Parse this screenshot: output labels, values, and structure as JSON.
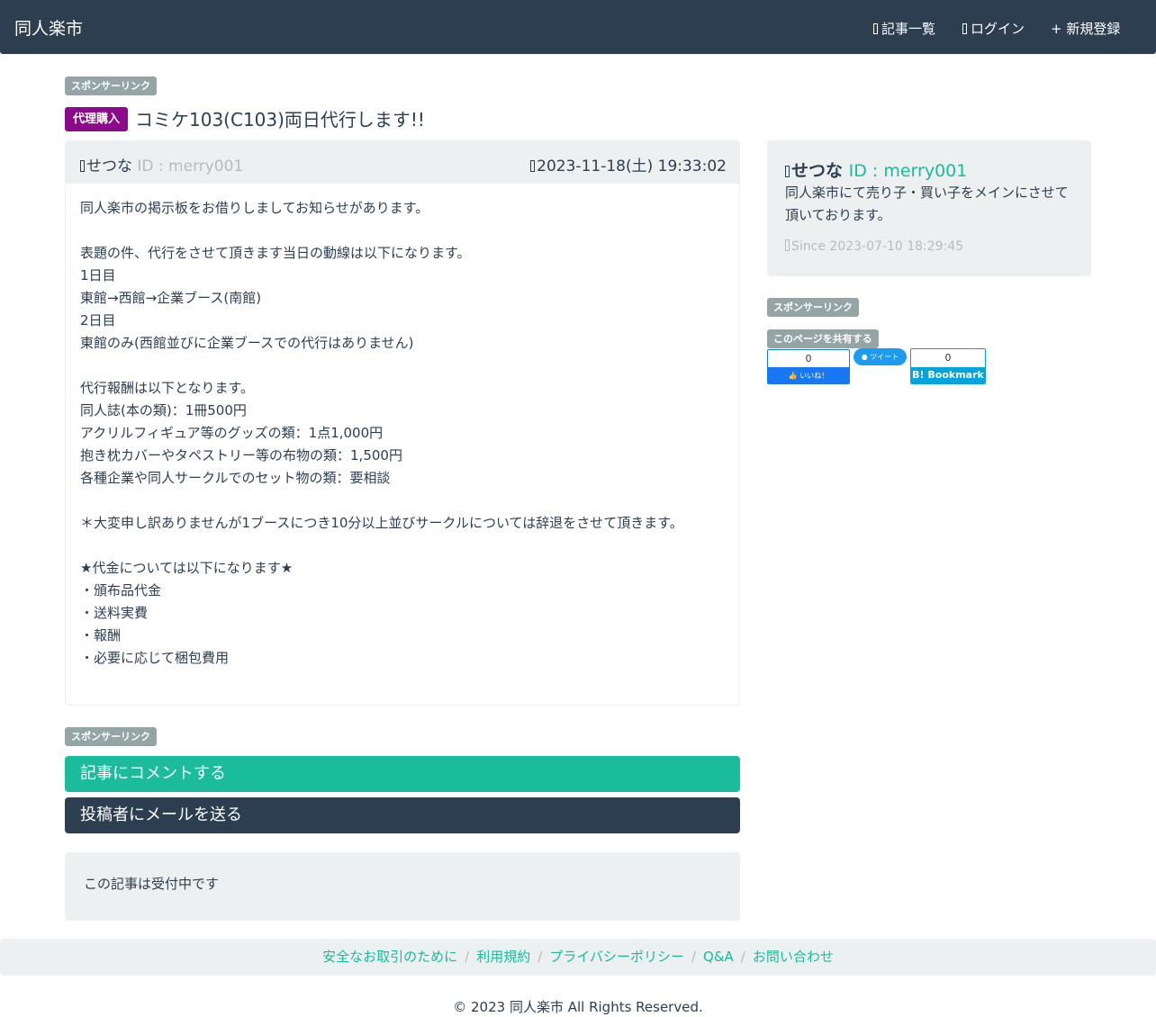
{
  "nav": {
    "brand": "同人楽市",
    "articles": "記事一覧",
    "login": "ログイン",
    "register": "+ 新規登録"
  },
  "ads": {
    "sponsor_label": "スポンサーリンク"
  },
  "post": {
    "category": "代理購入",
    "title": "コミケ103(C103)両日代行します!!",
    "author_name": "せつな",
    "author_id": "ID : merry001",
    "date": "2023-11-18(土) 19:33:02",
    "body": [
      "同人楽市の掲示板をお借りしましてお知らせがあります。",
      "",
      "表題の件、代行をさせて頂きます当日の動線は以下になります。",
      "1日目",
      "東館→西館→企業ブース(南館)",
      "2日目",
      "東館のみ(西館並びに企業ブースでの代行はありません)",
      "",
      "代行報酬は以下となります。",
      "同人誌(本の類)：1冊500円",
      "アクリルフィギュア等のグッズの類：1点1,000円",
      "抱き枕カバーやタペストリー等の布物の類：1,500円",
      "各種企業や同人サークルでのセット物の類：要相談",
      "",
      "＊大変申し訳ありませんが1ブースにつき10分以上並びサークルについては辞退をさせて頂きます。",
      "",
      "★代金については以下になります★",
      "・頒布品代金",
      "・送料実費",
      "・報酬",
      "・必要に応じて梱包費用"
    ]
  },
  "actions": {
    "comment": "記事にコメントする",
    "mail": "投稿者にメールを送る"
  },
  "status": {
    "text": "この記事は受付中です"
  },
  "sidebar": {
    "author_name": "せつな",
    "author_id": "ID : merry001",
    "description": "同人楽市にて売り子・買い子をメインにさせて頂いております。",
    "since": "Since 2023-07-10 18:29:45",
    "share_label": "このページを共有する",
    "fb_count": "0",
    "fb_button": "いいね！",
    "tw_button": "ツイート",
    "hb_count": "0",
    "hb_button": "B! Bookmark"
  },
  "footer": {
    "links": [
      "安全なお取引のために",
      "利用規約",
      "プライバシーポリシー",
      "Q&A",
      "お問い合わせ"
    ],
    "copyright": "© 2023 同人楽市 All Rights Reserved."
  },
  "colors": {
    "navbar": "#2c3e50",
    "accent": "#18bc9c",
    "category_badge": "#8b0a8b",
    "label_badge": "#95a5a6",
    "well": "#ecf0f1",
    "muted_text": "#b4bcc2"
  },
  "icons": {
    "articles": "list-icon",
    "login": "login-icon",
    "author": "user-icon",
    "date": "calendar-icon",
    "since": "clock-icon"
  }
}
